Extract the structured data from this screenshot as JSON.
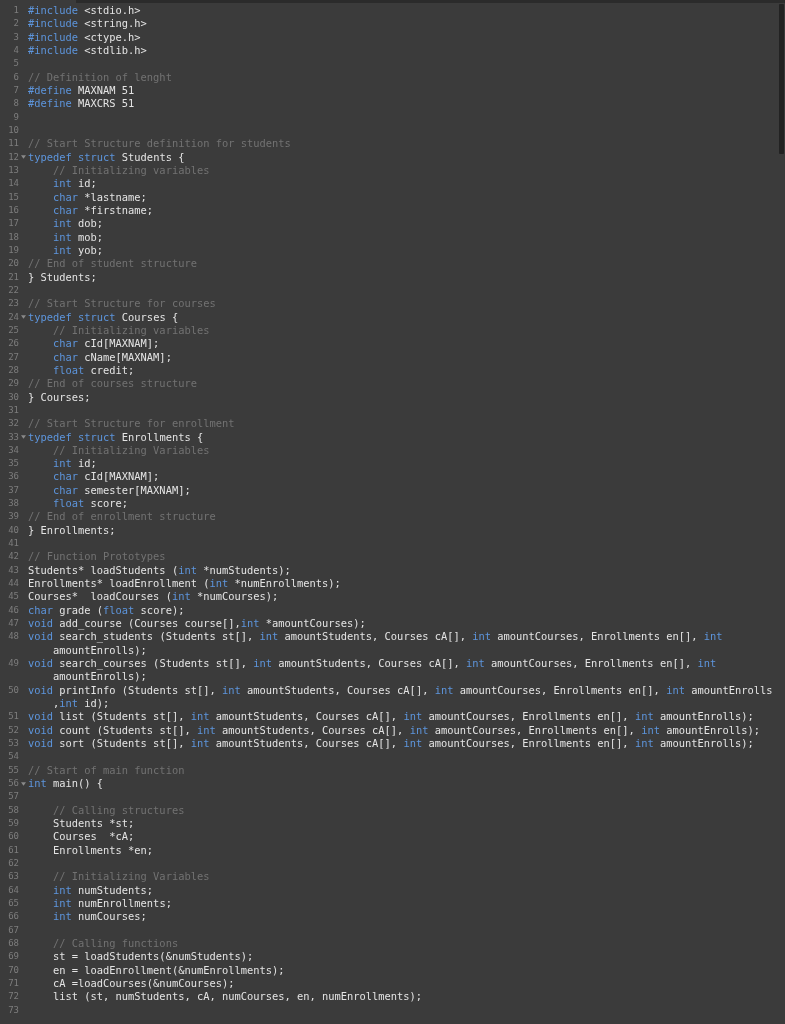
{
  "lines": [
    {
      "number": "1",
      "fold": false,
      "tokens": [
        {
          "text": "#include",
          "kind": "directive"
        },
        {
          "text": " <stdio.h>",
          "kind": "plain"
        }
      ]
    },
    {
      "number": "2",
      "fold": false,
      "tokens": [
        {
          "text": "#include",
          "kind": "directive"
        },
        {
          "text": " <string.h>",
          "kind": "plain"
        }
      ]
    },
    {
      "number": "3",
      "fold": false,
      "tokens": [
        {
          "text": "#include",
          "kind": "directive"
        },
        {
          "text": " <ctype.h>",
          "kind": "plain"
        }
      ]
    },
    {
      "number": "4",
      "fold": false,
      "tokens": [
        {
          "text": "#include",
          "kind": "directive"
        },
        {
          "text": " <stdlib.h>",
          "kind": "plain"
        }
      ]
    },
    {
      "number": "5",
      "fold": false
    },
    {
      "number": "6",
      "fold": false,
      "tokens": [
        {
          "text": "// Definition of lenght",
          "kind": "comment"
        }
      ]
    },
    {
      "number": "7",
      "fold": false,
      "tokens": [
        {
          "text": "#define",
          "kind": "directive"
        },
        {
          "text": " MAXNAM 51",
          "kind": "plain"
        }
      ]
    },
    {
      "number": "8",
      "fold": false,
      "tokens": [
        {
          "text": "#define",
          "kind": "directive"
        },
        {
          "text": " MAXCRS 51",
          "kind": "plain"
        }
      ]
    },
    {
      "number": "9",
      "fold": false
    },
    {
      "number": "10",
      "fold": false
    },
    {
      "number": "11",
      "fold": false,
      "tokens": [
        {
          "text": "// Start Structure definition for students",
          "kind": "comment"
        }
      ]
    },
    {
      "number": "12",
      "fold": true,
      "tokens": [
        {
          "text": "typedef struct",
          "kind": "keyword"
        },
        {
          "text": " Students {",
          "kind": "plain"
        }
      ]
    },
    {
      "number": "13",
      "fold": false,
      "tokens": [
        {
          "text": "    // Initializing variables",
          "kind": "comment"
        }
      ]
    },
    {
      "number": "14",
      "fold": false,
      "tokens": [
        {
          "text": "    int",
          "kind": "keyword"
        },
        {
          "text": " id;",
          "kind": "plain"
        }
      ]
    },
    {
      "number": "15",
      "fold": false,
      "tokens": [
        {
          "text": "    char",
          "kind": "keyword"
        },
        {
          "text": " *lastname;",
          "kind": "plain"
        }
      ]
    },
    {
      "number": "16",
      "fold": false,
      "tokens": [
        {
          "text": "    char",
          "kind": "keyword"
        },
        {
          "text": " *firstname;",
          "kind": "plain"
        }
      ]
    },
    {
      "number": "17",
      "fold": false,
      "tokens": [
        {
          "text": "    int",
          "kind": "keyword"
        },
        {
          "text": " dob;",
          "kind": "plain"
        }
      ]
    },
    {
      "number": "18",
      "fold": false,
      "tokens": [
        {
          "text": "    int",
          "kind": "keyword"
        },
        {
          "text": " mob;",
          "kind": "plain"
        }
      ]
    },
    {
      "number": "19",
      "fold": false,
      "tokens": [
        {
          "text": "    int",
          "kind": "keyword"
        },
        {
          "text": " yob;",
          "kind": "plain"
        }
      ]
    },
    {
      "number": "20",
      "fold": false,
      "tokens": [
        {
          "text": "// End of student structure",
          "kind": "comment"
        }
      ]
    },
    {
      "number": "21",
      "fold": false,
      "tokens": [
        {
          "text": "} Students;",
          "kind": "plain"
        }
      ]
    },
    {
      "number": "22",
      "fold": false
    },
    {
      "number": "23",
      "fold": false,
      "tokens": [
        {
          "text": "// Start Structure for courses",
          "kind": "comment"
        }
      ]
    },
    {
      "number": "24",
      "fold": true,
      "tokens": [
        {
          "text": "typedef struct",
          "kind": "keyword"
        },
        {
          "text": " Courses {",
          "kind": "plain"
        }
      ]
    },
    {
      "number": "25",
      "fold": false,
      "tokens": [
        {
          "text": "    // Initializing variables",
          "kind": "comment"
        }
      ]
    },
    {
      "number": "26",
      "fold": false,
      "tokens": [
        {
          "text": "    char",
          "kind": "keyword"
        },
        {
          "text": " cId[MAXNAM];",
          "kind": "plain"
        }
      ]
    },
    {
      "number": "27",
      "fold": false,
      "tokens": [
        {
          "text": "    char",
          "kind": "keyword"
        },
        {
          "text": " cName[MAXNAM];",
          "kind": "plain"
        }
      ]
    },
    {
      "number": "28",
      "fold": false,
      "tokens": [
        {
          "text": "    float",
          "kind": "keyword"
        },
        {
          "text": " credit;",
          "kind": "plain"
        }
      ]
    },
    {
      "number": "29",
      "fold": false,
      "tokens": [
        {
          "text": "// End of courses structure",
          "kind": "comment"
        }
      ]
    },
    {
      "number": "30",
      "fold": false,
      "tokens": [
        {
          "text": "} Courses;",
          "kind": "plain"
        }
      ]
    },
    {
      "number": "31",
      "fold": false
    },
    {
      "number": "32",
      "fold": false,
      "tokens": [
        {
          "text": "// Start Structure for enrollment",
          "kind": "comment"
        }
      ]
    },
    {
      "number": "33",
      "fold": true,
      "tokens": [
        {
          "text": "typedef struct",
          "kind": "keyword"
        },
        {
          "text": " Enrollments {",
          "kind": "plain"
        }
      ]
    },
    {
      "number": "34",
      "fold": false,
      "tokens": [
        {
          "text": "    // Initializing Variables",
          "kind": "comment"
        }
      ]
    },
    {
      "number": "35",
      "fold": false,
      "tokens": [
        {
          "text": "    int",
          "kind": "keyword"
        },
        {
          "text": " id;",
          "kind": "plain"
        }
      ]
    },
    {
      "number": "36",
      "fold": false,
      "tokens": [
        {
          "text": "    char",
          "kind": "keyword"
        },
        {
          "text": " cId[MAXNAM];",
          "kind": "plain"
        }
      ]
    },
    {
      "number": "37",
      "fold": false,
      "tokens": [
        {
          "text": "    char",
          "kind": "keyword"
        },
        {
          "text": " semester[MAXNAM];",
          "kind": "plain"
        }
      ]
    },
    {
      "number": "38",
      "fold": false,
      "tokens": [
        {
          "text": "    float",
          "kind": "keyword"
        },
        {
          "text": " score;",
          "kind": "plain"
        }
      ]
    },
    {
      "number": "39",
      "fold": false,
      "tokens": [
        {
          "text": "// End of enrollment structure",
          "kind": "comment"
        }
      ]
    },
    {
      "number": "40",
      "fold": false,
      "tokens": [
        {
          "text": "} Enrollments;",
          "kind": "plain"
        }
      ]
    },
    {
      "number": "41",
      "fold": false
    },
    {
      "number": "42",
      "fold": false,
      "tokens": [
        {
          "text": "// Function Prototypes",
          "kind": "comment"
        }
      ]
    },
    {
      "number": "43",
      "fold": false,
      "tokens": [
        {
          "text": "Students* loadStudents (",
          "kind": "plain"
        },
        {
          "text": "int",
          "kind": "keyword"
        },
        {
          "text": " *numStudents);",
          "kind": "plain"
        }
      ]
    },
    {
      "number": "44",
      "fold": false,
      "tokens": [
        {
          "text": "Enrollments* loadEnrollment (",
          "kind": "plain"
        },
        {
          "text": "int",
          "kind": "keyword"
        },
        {
          "text": " *numEnrollments);",
          "kind": "plain"
        }
      ]
    },
    {
      "number": "45",
      "fold": false,
      "tokens": [
        {
          "text": "Courses*  loadCourses (",
          "kind": "plain"
        },
        {
          "text": "int",
          "kind": "keyword"
        },
        {
          "text": " *numCourses);",
          "kind": "plain"
        }
      ]
    },
    {
      "number": "46",
      "fold": false,
      "tokens": [
        {
          "text": "char",
          "kind": "keyword"
        },
        {
          "text": " grade (",
          "kind": "plain"
        },
        {
          "text": "float",
          "kind": "keyword"
        },
        {
          "text": " score);",
          "kind": "plain"
        }
      ]
    },
    {
      "number": "47",
      "fold": false,
      "tokens": [
        {
          "text": "void",
          "kind": "keyword"
        },
        {
          "text": " add_course (Courses course[],",
          "kind": "plain"
        },
        {
          "text": "int",
          "kind": "keyword"
        },
        {
          "text": " *amountCourses);",
          "kind": "plain"
        }
      ]
    },
    {
      "number": "48",
      "fold": false,
      "tokens": [
        {
          "text": "void",
          "kind": "keyword"
        },
        {
          "text": " search_students (Students st[], ",
          "kind": "plain"
        },
        {
          "text": "int",
          "kind": "keyword"
        },
        {
          "text": " amountStudents, Courses cA[], ",
          "kind": "plain"
        },
        {
          "text": "int",
          "kind": "keyword"
        },
        {
          "text": " amountCourses, Enrollments en[], ",
          "kind": "plain"
        },
        {
          "text": "int",
          "kind": "keyword"
        },
        {
          "kind": "wrap"
        },
        {
          "text": "amountEnrolls);",
          "kind": "plain"
        }
      ]
    },
    {
      "number": "49",
      "fold": false,
      "tokens": [
        {
          "text": "void",
          "kind": "keyword"
        },
        {
          "text": " search_courses (Students st[], ",
          "kind": "plain"
        },
        {
          "text": "int",
          "kind": "keyword"
        },
        {
          "text": " amountStudents, Courses cA[], ",
          "kind": "plain"
        },
        {
          "text": "int",
          "kind": "keyword"
        },
        {
          "text": " amountCourses, Enrollments en[], ",
          "kind": "plain"
        },
        {
          "text": "int",
          "kind": "keyword"
        },
        {
          "kind": "wrap"
        },
        {
          "text": "amountEnrolls);",
          "kind": "plain"
        }
      ]
    },
    {
      "number": "50",
      "fold": false,
      "tokens": [
        {
          "text": "void",
          "kind": "keyword"
        },
        {
          "text": " printInfo (Students st[], ",
          "kind": "plain"
        },
        {
          "text": "int",
          "kind": "keyword"
        },
        {
          "text": " amountStudents, Courses cA[], ",
          "kind": "plain"
        },
        {
          "text": "int",
          "kind": "keyword"
        },
        {
          "text": " amountCourses, Enrollments en[], ",
          "kind": "plain"
        },
        {
          "text": "int",
          "kind": "keyword"
        },
        {
          "text": " amountEnrolls",
          "kind": "plain"
        },
        {
          "kind": "wrap"
        },
        {
          "text": ",",
          "kind": "plain"
        },
        {
          "text": "int",
          "kind": "keyword"
        },
        {
          "text": " id);",
          "kind": "plain"
        }
      ]
    },
    {
      "number": "51",
      "fold": false,
      "tokens": [
        {
          "text": "void",
          "kind": "keyword"
        },
        {
          "text": " list (Students st[], ",
          "kind": "plain"
        },
        {
          "text": "int",
          "kind": "keyword"
        },
        {
          "text": " amountStudents, Courses cA[], ",
          "kind": "plain"
        },
        {
          "text": "int",
          "kind": "keyword"
        },
        {
          "text": " amountCourses, Enrollments en[], ",
          "kind": "plain"
        },
        {
          "text": "int",
          "kind": "keyword"
        },
        {
          "text": " amountEnrolls);",
          "kind": "plain"
        }
      ]
    },
    {
      "number": "52",
      "fold": false,
      "tokens": [
        {
          "text": "void",
          "kind": "keyword"
        },
        {
          "text": " count (Students st[], ",
          "kind": "plain"
        },
        {
          "text": "int",
          "kind": "keyword"
        },
        {
          "text": " amountStudents, Courses cA[], ",
          "kind": "plain"
        },
        {
          "text": "int",
          "kind": "keyword"
        },
        {
          "text": " amountCourses, Enrollments en[], ",
          "kind": "plain"
        },
        {
          "text": "int",
          "kind": "keyword"
        },
        {
          "text": " amountEnrolls);",
          "kind": "plain"
        }
      ]
    },
    {
      "number": "53",
      "fold": false,
      "tokens": [
        {
          "text": "void",
          "kind": "keyword"
        },
        {
          "text": " sort (Students st[], ",
          "kind": "plain"
        },
        {
          "text": "int",
          "kind": "keyword"
        },
        {
          "text": " amountStudents, Courses cA[], ",
          "kind": "plain"
        },
        {
          "text": "int",
          "kind": "keyword"
        },
        {
          "text": " amountCourses, Enrollments en[], ",
          "kind": "plain"
        },
        {
          "text": "int",
          "kind": "keyword"
        },
        {
          "text": " amountEnrolls);",
          "kind": "plain"
        }
      ]
    },
    {
      "number": "54",
      "fold": false
    },
    {
      "number": "55",
      "fold": false,
      "tokens": [
        {
          "text": "// Start of main function",
          "kind": "comment"
        }
      ]
    },
    {
      "number": "56",
      "fold": true,
      "tokens": [
        {
          "text": "int",
          "kind": "keyword"
        },
        {
          "text": " main() {",
          "kind": "plain"
        }
      ]
    },
    {
      "number": "57",
      "fold": false
    },
    {
      "number": "58",
      "fold": false,
      "tokens": [
        {
          "text": "    // Calling structures",
          "kind": "comment"
        }
      ]
    },
    {
      "number": "59",
      "fold": false,
      "tokens": [
        {
          "text": "    Students *st;",
          "kind": "plain"
        }
      ]
    },
    {
      "number": "60",
      "fold": false,
      "tokens": [
        {
          "text": "    Courses  *cA;",
          "kind": "plain"
        }
      ]
    },
    {
      "number": "61",
      "fold": false,
      "tokens": [
        {
          "text": "    Enrollments *en;",
          "kind": "plain"
        }
      ]
    },
    {
      "number": "62",
      "fold": false
    },
    {
      "number": "63",
      "fold": false,
      "tokens": [
        {
          "text": "    // Initializing Variables",
          "kind": "comment"
        }
      ]
    },
    {
      "number": "64",
      "fold": false,
      "tokens": [
        {
          "text": "    int",
          "kind": "keyword"
        },
        {
          "text": " numStudents;",
          "kind": "plain"
        }
      ]
    },
    {
      "number": "65",
      "fold": false,
      "tokens": [
        {
          "text": "    int",
          "kind": "keyword"
        },
        {
          "text": " numEnrollments;",
          "kind": "plain"
        }
      ]
    },
    {
      "number": "66",
      "fold": false,
      "tokens": [
        {
          "text": "    int",
          "kind": "keyword"
        },
        {
          "text": " numCourses;",
          "kind": "plain"
        }
      ]
    },
    {
      "number": "67",
      "fold": false
    },
    {
      "number": "68",
      "fold": false,
      "tokens": [
        {
          "text": "    // Calling functions",
          "kind": "comment"
        }
      ]
    },
    {
      "number": "69",
      "fold": false,
      "tokens": [
        {
          "text": "    st = loadStudents(&numStudents);",
          "kind": "plain"
        }
      ]
    },
    {
      "number": "70",
      "fold": false,
      "tokens": [
        {
          "text": "    en = loadEnrollment(&numEnrollments);",
          "kind": "plain"
        }
      ]
    },
    {
      "number": "71",
      "fold": false,
      "tokens": [
        {
          "text": "    cA =loadCourses(&numCourses);",
          "kind": "plain"
        }
      ]
    },
    {
      "number": "72",
      "fold": false,
      "tokens": [
        {
          "text": "    list (st, numStudents, cA, numCourses, en, numEnrollments);",
          "kind": "plain"
        }
      ]
    },
    {
      "number": "73",
      "fold": false
    }
  ]
}
